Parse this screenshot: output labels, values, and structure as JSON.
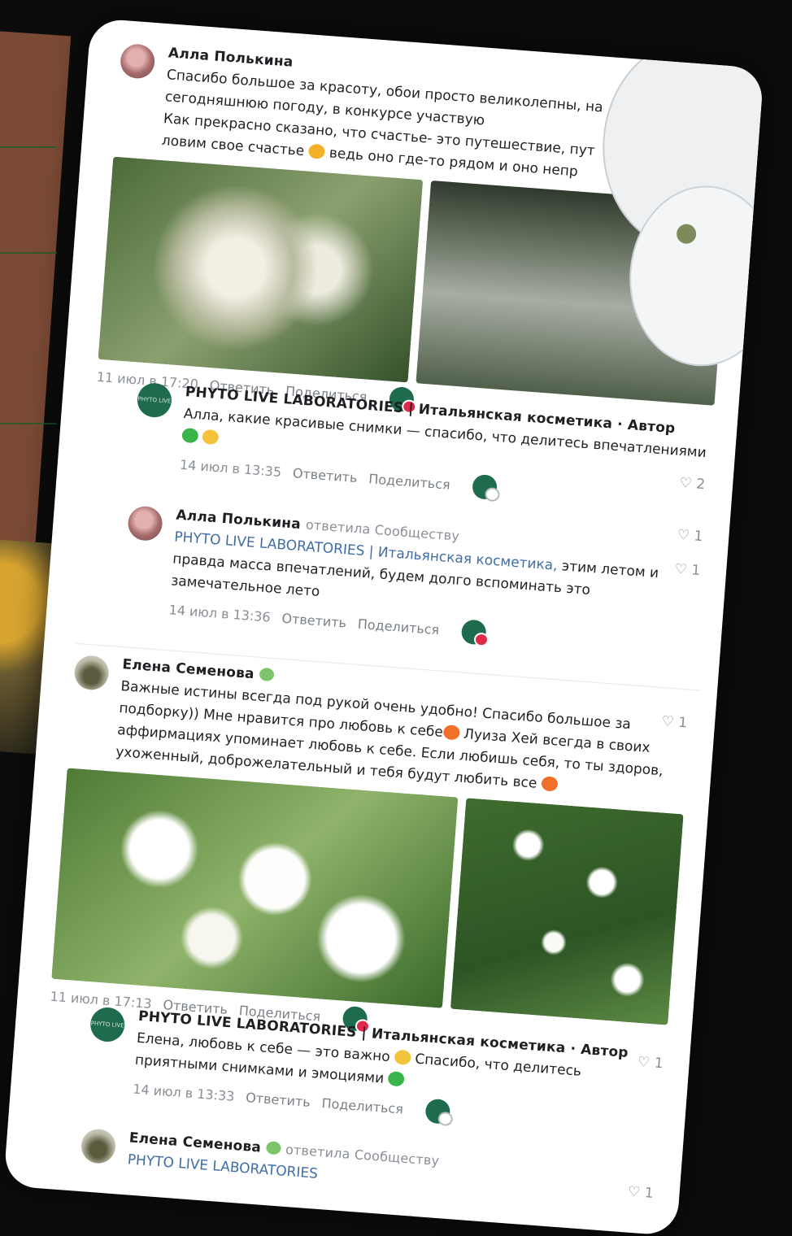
{
  "comments": [
    {
      "author": "Алла Полькина",
      "text_lines": [
        "Спасибо большое за красоту, обои просто великолепны, на",
        "сегодняшнюю погоду, в конкурсе участвую",
        "Как прекрасно сказано, что счастье- это путешествие, пут",
        "ловим свое счастье",
        "ведь оно где-то рядом и оно непр"
      ],
      "date": "11 июл в 17:20",
      "reply_label": "Ответить",
      "share_label": "Поделиться",
      "likes": "2"
    },
    {
      "author": "PHYTO LIVE LABORATORIES | Итальянская косметика · Автор",
      "text_lines": [
        "Алла, какие красивые снимки — спасибо, что делитесь впечатлениями"
      ],
      "date": "14 июл в 13:35",
      "reply_label": "Ответить",
      "share_label": "Поделиться",
      "likes": "1"
    },
    {
      "author": "Алла Полькина",
      "sub": "ответила Сообществу",
      "mention": "PHYTO LIVE LABORATORIES | Итальянская косметика,",
      "text_lines": [
        "этим летом и",
        "правда масса впечатлений, будем долго вспоминать это",
        "замечательное лето"
      ],
      "date": "14 июл в 13:36",
      "reply_label": "Ответить",
      "share_label": "Поделиться",
      "likes": "1"
    },
    {
      "author": "Елена Семенова",
      "text_lines": [
        "Важные истины всегда под рукой очень удобно! Спасибо большое за",
        "подборку)) Мне нравится про любовь к себе",
        "Луиза Хей всегда в своих",
        "аффирмациях упоминает любовь к себе. Если любишь себя, то ты здоров,",
        "ухоженный, доброжелательный и тебя будут любить все"
      ],
      "date": "11 июл в 17:13",
      "reply_label": "Ответить",
      "share_label": "Поделиться",
      "likes": "1"
    },
    {
      "author": "PHYTO LIVE LABORATORIES | Итальянская косметика · Автор",
      "text_lines": [
        "Елена, любовь к себе — это важно",
        "Спасибо, что делитесь",
        "приятными снимками и эмоциями"
      ],
      "date": "14 июл в 13:33",
      "reply_label": "Ответить",
      "share_label": "Поделиться",
      "likes": "1"
    },
    {
      "author": "Елена Семенова",
      "sub": "ответила Сообществу",
      "mention": "PHYTO LIVE LABORATORIES",
      "likes": "1"
    }
  ],
  "avatar_text": "PHYTO LIVE",
  "colors": {
    "accent_link": "#3f6ea6",
    "meta": "#8a8f96",
    "like_badge": "#e0284a",
    "community": "#1f6b4e"
  }
}
